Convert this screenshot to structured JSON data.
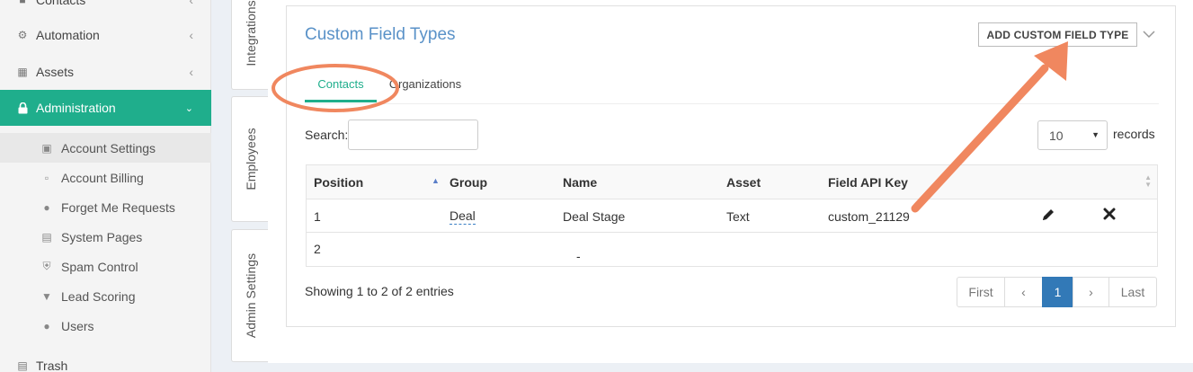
{
  "sidebar": {
    "items": [
      {
        "label": "Contacts",
        "icon": "user-icon"
      },
      {
        "label": "Automation",
        "icon": "cogs-icon"
      },
      {
        "label": "Assets",
        "icon": "grid-icon"
      },
      {
        "label": "Administration",
        "icon": "lock-icon"
      },
      {
        "label": "Trash",
        "icon": "trash-icon"
      }
    ],
    "sub_items": [
      {
        "label": "Account Settings",
        "icon": "sitemap-icon"
      },
      {
        "label": "Account Billing",
        "icon": "document-icon"
      },
      {
        "label": "Forget Me Requests",
        "icon": "user-remove-icon"
      },
      {
        "label": "System Pages",
        "icon": "newspaper-icon"
      },
      {
        "label": "Spam Control",
        "icon": "shield-icon"
      },
      {
        "label": "Lead Scoring",
        "icon": "filter-icon"
      },
      {
        "label": "Users",
        "icon": "user-icon"
      }
    ]
  },
  "vertical_tabs": [
    "Integrations",
    "Employees",
    "Admin Settings"
  ],
  "panel": {
    "title": "Custom Field Types",
    "add_button": "ADD CUSTOM FIELD TYPE",
    "tabs": [
      "Contacts",
      "Organizations"
    ],
    "search_label": "Search:",
    "search_value": "",
    "page_length": "10",
    "records_label": "records",
    "columns": [
      "Position",
      "Group",
      "Name",
      "Asset",
      "Field API Key"
    ],
    "rows": [
      {
        "position": "1",
        "group": "Deal",
        "name": "Deal Stage",
        "asset": "Text",
        "api_key": "custom_21129"
      },
      {
        "position": "2",
        "group": "",
        "name": "-",
        "asset": "",
        "api_key": ""
      }
    ],
    "showing": "Showing 1 to 2 of 2 entries",
    "pagination": [
      "First",
      "‹",
      "1",
      "›",
      "Last"
    ]
  },
  "colors": {
    "accent": "#1fae8c",
    "title": "#5a92c8",
    "page_active": "#3279b7",
    "annotation": "#f0875f"
  }
}
